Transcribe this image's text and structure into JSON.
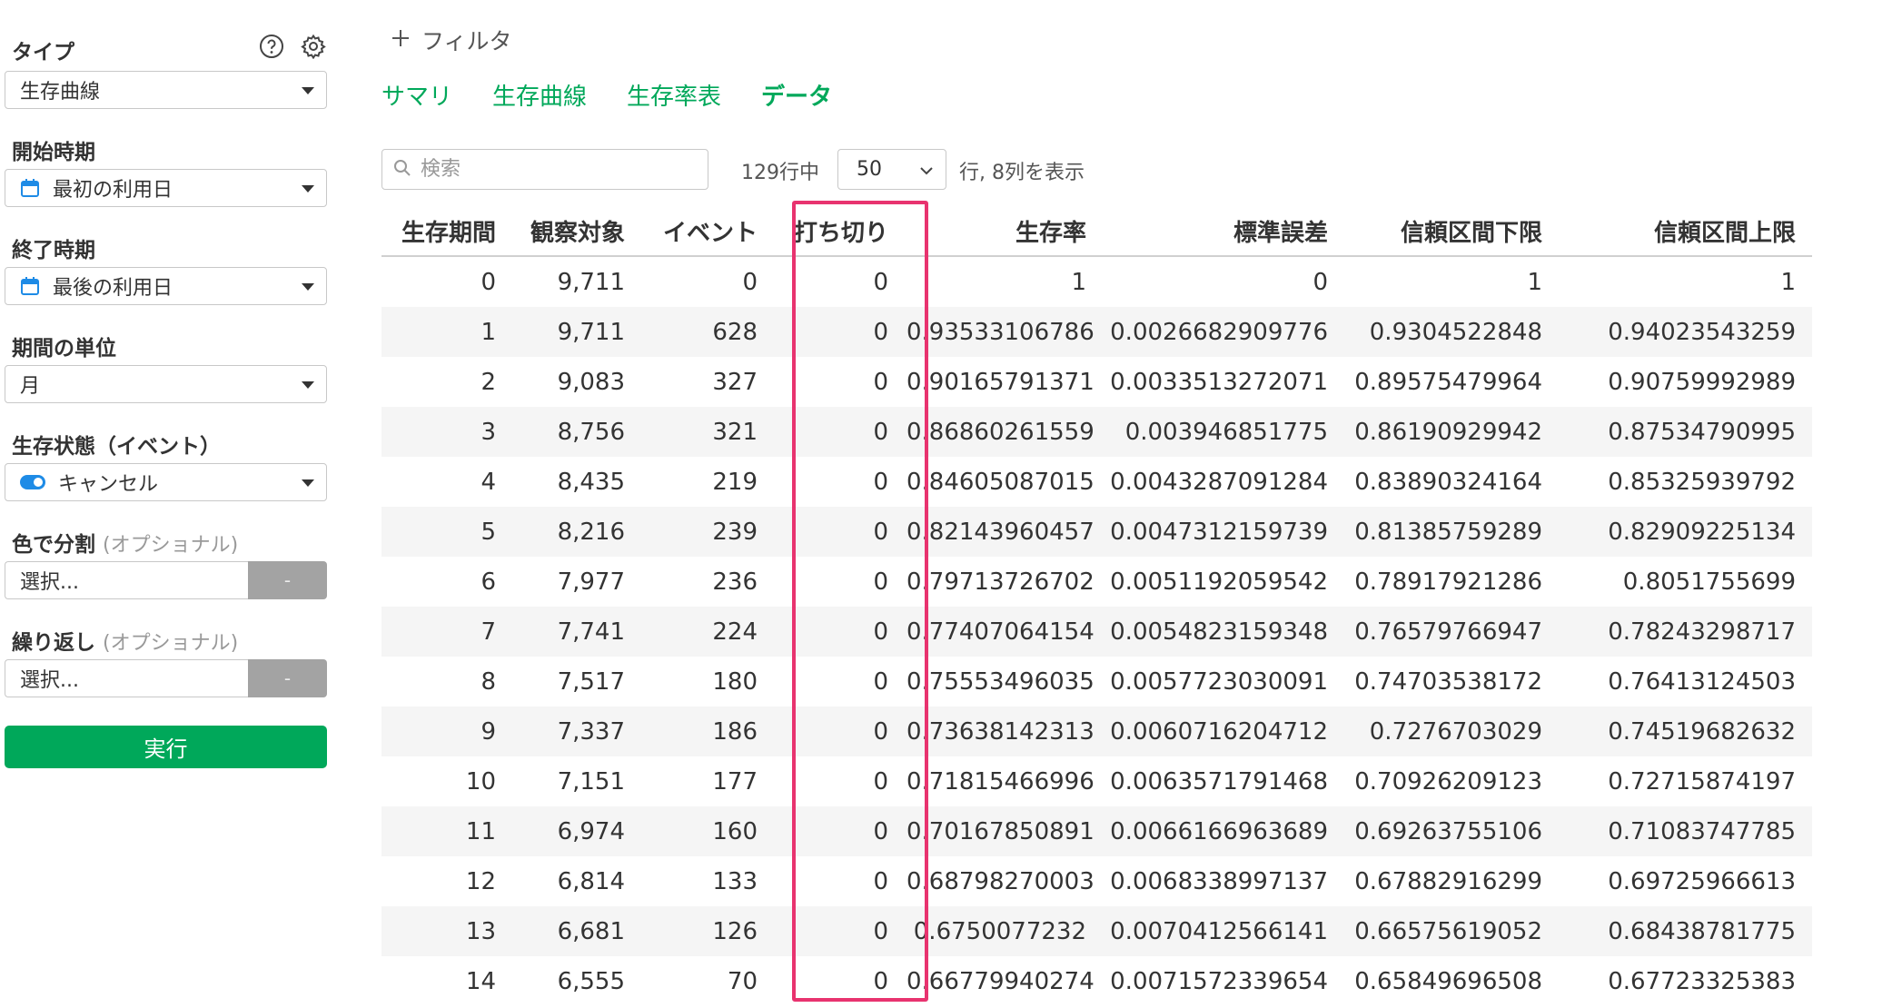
{
  "sidebar": {
    "type_label": "タイプ",
    "type_value": "生存曲線",
    "start_label": "開始時期",
    "start_value": "最初の利用日",
    "end_label": "終了時期",
    "end_value": "最後の利用日",
    "unit_label": "期間の単位",
    "unit_value": "月",
    "event_label": "生存状態（イベント）",
    "event_value": "キャンセル",
    "color_label": "色で分割",
    "optional": "(オプショナル)",
    "color_value": "選択...",
    "repeat_label": "繰り返し",
    "repeat_value": "選択...",
    "dash": "-",
    "run_label": "実行"
  },
  "toolbar": {
    "filter_label": "フィルタ",
    "search_placeholder": "検索",
    "rows_text": "129行中",
    "page_size": "50",
    "cols_text": "行, 8列を表示"
  },
  "tabs": [
    {
      "label": "サマリ"
    },
    {
      "label": "生存曲線"
    },
    {
      "label": "生存率表"
    },
    {
      "label": "データ"
    }
  ],
  "table": {
    "headers": [
      "生存期間",
      "観察対象",
      "イベント",
      "打ち切り",
      "生存率",
      "標準誤差",
      "信頼区間下限",
      "信頼区間上限"
    ],
    "rows": [
      [
        "0",
        "9,711",
        "0",
        "0",
        "1",
        "0",
        "1",
        "1"
      ],
      [
        "1",
        "9,711",
        "628",
        "0",
        "0.93533106786",
        "0.0026682909776",
        "0.9304522848",
        "0.94023543259"
      ],
      [
        "2",
        "9,083",
        "327",
        "0",
        "0.90165791371",
        "0.0033513272071",
        "0.89575479964",
        "0.90759992989"
      ],
      [
        "3",
        "8,756",
        "321",
        "0",
        "0.86860261559",
        "0.003946851775",
        "0.86190929942",
        "0.87534790995"
      ],
      [
        "4",
        "8,435",
        "219",
        "0",
        "0.84605087015",
        "0.0043287091284",
        "0.83890324164",
        "0.85325939792"
      ],
      [
        "5",
        "8,216",
        "239",
        "0",
        "0.82143960457",
        "0.0047312159739",
        "0.81385759289",
        "0.82909225134"
      ],
      [
        "6",
        "7,977",
        "236",
        "0",
        "0.79713726702",
        "0.0051192059542",
        "0.78917921286",
        "0.8051755699"
      ],
      [
        "7",
        "7,741",
        "224",
        "0",
        "0.77407064154",
        "0.0054823159348",
        "0.76579766947",
        "0.78243298717"
      ],
      [
        "8",
        "7,517",
        "180",
        "0",
        "0.75553496035",
        "0.0057723030091",
        "0.74703538172",
        "0.76413124503"
      ],
      [
        "9",
        "7,337",
        "186",
        "0",
        "0.73638142313",
        "0.0060716204712",
        "0.7276703029",
        "0.74519682632"
      ],
      [
        "10",
        "7,151",
        "177",
        "0",
        "0.71815466996",
        "0.0063571791468",
        "0.70926209123",
        "0.72715874197"
      ],
      [
        "11",
        "6,974",
        "160",
        "0",
        "0.70167850891",
        "0.0066166963689",
        "0.69263755106",
        "0.71083747785"
      ],
      [
        "12",
        "6,814",
        "133",
        "0",
        "0.68798270003",
        "0.0068338997137",
        "0.67882916299",
        "0.69725966613"
      ],
      [
        "13",
        "6,681",
        "126",
        "0",
        "0.6750077232",
        "0.0070412566141",
        "0.66575619052",
        "0.68438781775"
      ],
      [
        "14",
        "6,555",
        "70",
        "0",
        "0.66779940274",
        "0.0071572339654",
        "0.65849696508",
        "0.67723325383"
      ]
    ]
  },
  "colors": {
    "accent": "#00a85a",
    "highlight": "#e8336f",
    "toggle": "#1e8be6"
  },
  "icons": {
    "help": "help-icon",
    "settings": "gear-icon",
    "calendar": "calendar-icon",
    "search": "search-icon",
    "plus": "plus-icon"
  }
}
